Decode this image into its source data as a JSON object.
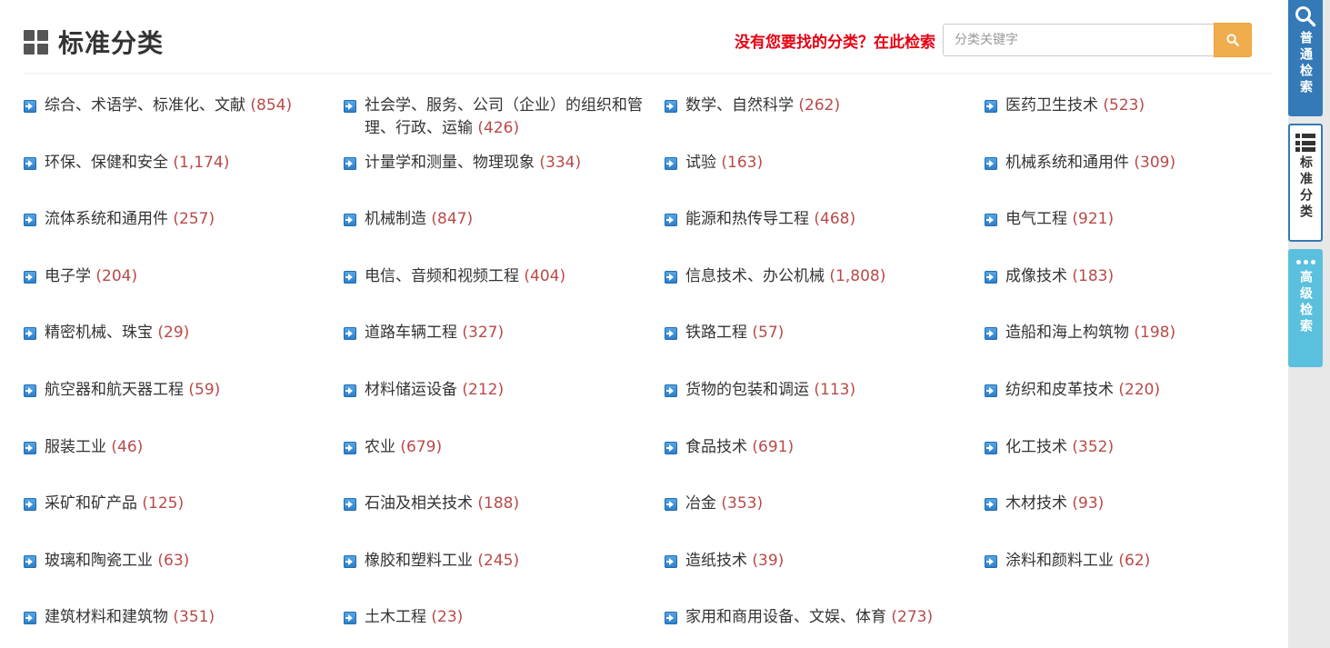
{
  "header": {
    "title": "标准分类",
    "search_hint": "没有您要找的分类？在此检索",
    "search_placeholder": "分类关键字"
  },
  "categories": [
    {
      "name": "综合、术语学、标准化、文献",
      "count": "(854)"
    },
    {
      "name": "社会学、服务、公司（企业）的组织和管理、行政、运输",
      "count": "(426)"
    },
    {
      "name": "数学、自然科学",
      "count": "(262)"
    },
    {
      "name": "医药卫生技术",
      "count": "(523)"
    },
    {
      "name": "环保、保健和安全",
      "count": "(1,174)"
    },
    {
      "name": "计量学和测量、物理现象",
      "count": "(334)"
    },
    {
      "name": "试验",
      "count": "(163)"
    },
    {
      "name": "机械系统和通用件",
      "count": "(309)"
    },
    {
      "name": "流体系统和通用件",
      "count": "(257)"
    },
    {
      "name": "机械制造",
      "count": "(847)"
    },
    {
      "name": "能源和热传导工程",
      "count": "(468)"
    },
    {
      "name": "电气工程",
      "count": "(921)"
    },
    {
      "name": "电子学",
      "count": "(204)"
    },
    {
      "name": "电信、音频和视频工程",
      "count": "(404)"
    },
    {
      "name": "信息技术、办公机械",
      "count": "(1,808)"
    },
    {
      "name": "成像技术",
      "count": "(183)"
    },
    {
      "name": "精密机械、珠宝",
      "count": "(29)"
    },
    {
      "name": "道路车辆工程",
      "count": "(327)"
    },
    {
      "name": "铁路工程",
      "count": "(57)"
    },
    {
      "name": "造船和海上构筑物",
      "count": "(198)"
    },
    {
      "name": "航空器和航天器工程",
      "count": "(59)"
    },
    {
      "name": "材料储运设备",
      "count": "(212)"
    },
    {
      "name": "货物的包装和调运",
      "count": "(113)"
    },
    {
      "name": "纺织和皮革技术",
      "count": "(220)"
    },
    {
      "name": "服装工业",
      "count": "(46)"
    },
    {
      "name": "农业",
      "count": "(679)"
    },
    {
      "name": "食品技术",
      "count": "(691)"
    },
    {
      "name": "化工技术",
      "count": "(352)"
    },
    {
      "name": "采矿和矿产品",
      "count": "(125)"
    },
    {
      "name": "石油及相关技术",
      "count": "(188)"
    },
    {
      "name": "冶金",
      "count": "(353)"
    },
    {
      "name": "木材技术",
      "count": "(93)"
    },
    {
      "name": "玻璃和陶瓷工业",
      "count": "(63)"
    },
    {
      "name": "橡胶和塑料工业",
      "count": "(245)"
    },
    {
      "name": "造纸技术",
      "count": "(39)"
    },
    {
      "name": "涂料和颜料工业",
      "count": "(62)"
    },
    {
      "name": "建筑材料和建筑物",
      "count": "(351)"
    },
    {
      "name": "土木工程",
      "count": "(23)"
    },
    {
      "name": "家用和商用设备、文娱、体育",
      "count": "(273)"
    }
  ],
  "side_panel": {
    "search_label": "普通检索",
    "category_label": "标准分类",
    "advanced_label": "高级检索"
  },
  "colors": {
    "primary": "#337ab7",
    "accent": "#f0ad4e",
    "info": "#5bc0de",
    "hint_red": "#e60012",
    "count_red": "#b94a48"
  },
  "icons": {
    "title": "grid-icon",
    "search": "search-icon",
    "category": "list-icon",
    "advanced": "dots-icon",
    "item": "arrow-right-icon"
  }
}
